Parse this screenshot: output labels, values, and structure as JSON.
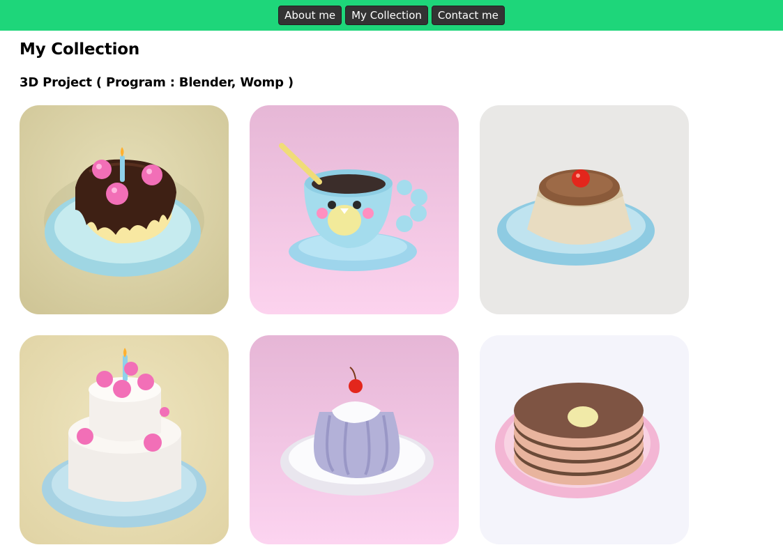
{
  "nav": {
    "about": "About me",
    "collection": "My Collection",
    "contact": "Contact me"
  },
  "page": {
    "title": "My Collection",
    "subtitle": "3D Project ( Program : Blender, Womp )"
  },
  "colors": {
    "topbar": "#1ed67a",
    "nav_button": "#333333"
  },
  "gallery": [
    {
      "subject": "chocolate-cake",
      "background": "#d8cfa6"
    },
    {
      "subject": "bird-cup",
      "background": "#f3c8e2"
    },
    {
      "subject": "pudding",
      "background": "#e9e8e6"
    },
    {
      "subject": "layer-cake",
      "background": "#e4d9b0"
    },
    {
      "subject": "jelly",
      "background": "#f0c8e6"
    },
    {
      "subject": "pancakes",
      "background": "#f4f4fb"
    }
  ]
}
